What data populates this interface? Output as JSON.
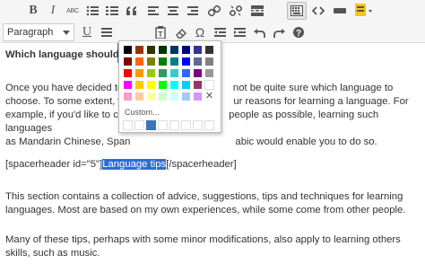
{
  "toolbar": {
    "row1": [
      "bold",
      "italic",
      "strikethrough",
      "bullet-list",
      "numbered-list",
      "blockquote",
      "align-left",
      "align-center",
      "align-right",
      "link",
      "unlink",
      "read-more",
      "toolbar-toggle",
      "code",
      "media",
      "highlight"
    ],
    "bold_label": "B",
    "italic_label": "I",
    "strike_label": "ABC",
    "format_select": {
      "value": "Paragraph"
    },
    "underline_label": "U",
    "text_color_label": "A",
    "text_color": "#000000",
    "special_char_label": "Ω",
    "highlight_color": "#f5c518"
  },
  "content": {
    "heading": "Which language should I l",
    "p2_a": "Once you have decided to l",
    "p2_b": "not be quite sure which language to",
    "p2_c": "choose. To some extent, yo",
    "p2_d": "ur reasons for learning a language. For",
    "p2_e": "example, if you'd like to co",
    "p2_f": "people as possible, learning such languages",
    "p2_g": "as Mandarin Chinese, Span",
    "p2_h": "abic would enable you to do so.",
    "shortcode_open": "[spacerheader id=\"5\"]",
    "shortcode_selected": "Language tips",
    "shortcode_close": "[/spacerheader]",
    "p4": "This section contains a collection of advice, suggestions, tips and techniques for learning languages. Most are based on my own experiences, while some come from other people.",
    "p5": "Many of these tips, perhaps with some minor modifications, also apply to learning others skills, such as music."
  },
  "color_picker": {
    "custom_label": "Custom...",
    "remove_label": "✕",
    "custom_picked": "#3a75b8",
    "colors": [
      [
        "#000000",
        "#993300",
        "#333300",
        "#003300",
        "#003366",
        "#000080",
        "#333399",
        "#333333"
      ],
      [
        "#800000",
        "#ff6600",
        "#808000",
        "#008000",
        "#008080",
        "#0000ff",
        "#666699",
        "#808080"
      ],
      [
        "#ff0000",
        "#ff9900",
        "#99cc00",
        "#339966",
        "#33cccc",
        "#3366ff",
        "#800080",
        "#999999"
      ],
      [
        "#ff00ff",
        "#ffcc00",
        "#ffff00",
        "#00ff00",
        "#00ffff",
        "#00ccff",
        "#993366",
        "#ffffff"
      ],
      [
        "#ff99cc",
        "#ffcc99",
        "#ffff99",
        "#ccffcc",
        "#ccffff",
        "#99ccff",
        "#cc99ff",
        null
      ]
    ]
  }
}
